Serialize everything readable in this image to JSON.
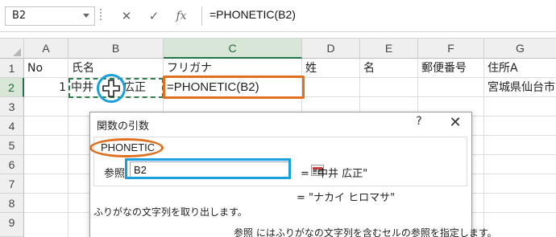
{
  "formula_bar": {
    "name_box": "B2",
    "cancel_symbol": "✕",
    "enter_symbol": "✓",
    "fx_symbol": "fx",
    "formula": "=PHONETIC(B2)"
  },
  "columns": [
    "A",
    "B",
    "C",
    "D",
    "E",
    "F",
    "G"
  ],
  "selected_column": "C",
  "rows": [
    "1",
    "2",
    "3",
    "4",
    "5",
    "6",
    "7",
    "8",
    "9"
  ],
  "selected_row": "2",
  "cells": {
    "a1": "No",
    "b1": "氏名",
    "c1": "フリガナ",
    "d1": "姓",
    "e1": "名",
    "f1": "郵便番号",
    "g1": "住所A",
    "a2": "1",
    "b2_left": "中井",
    "b2_right": "広正",
    "c2": "=PHONETIC(B2)",
    "g2": "宮城県仙台市"
  },
  "dialog": {
    "title": "関数の引数",
    "help": "?",
    "close": "✕",
    "function_name": "PHONETIC",
    "arg_label": "参照",
    "arg_value": "B2",
    "arg_result": "= \"中井 広正\"",
    "result": "= \"ナカイ ヒロマサ\"",
    "description": "ふりがなの文字列を取り出します。",
    "arg_help": "参照 にはふりがなの文字列を含むセルの参照を指定します。"
  },
  "colors": {
    "accent_green": "#217346",
    "highlight_orange": "#e07020",
    "highlight_blue": "#1aa0dc"
  }
}
